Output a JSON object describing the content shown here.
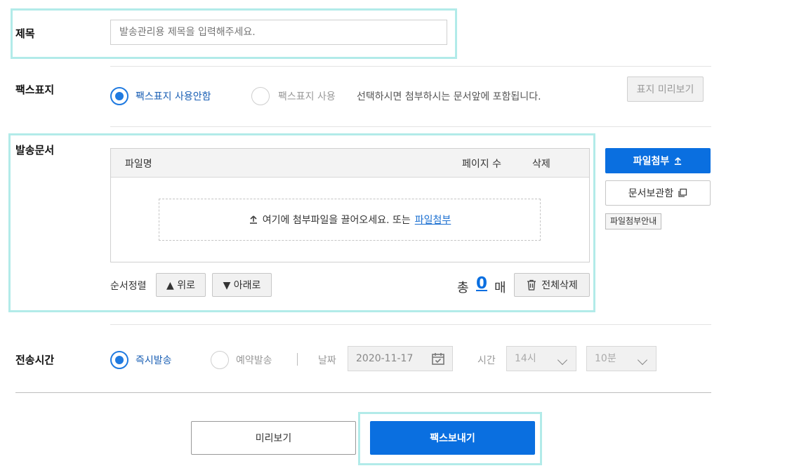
{
  "title_row": {
    "label": "제목",
    "placeholder": "발송관리용 제목을 입력해주세요."
  },
  "cover_row": {
    "label": "팩스표지",
    "option_off": "팩스표지 사용안함",
    "option_on": "팩스표지 사용",
    "hint": "선택하시면 첨부하시는 문서앞에 포함됩니다.",
    "preview_button": "표지 미리보기"
  },
  "docs_row": {
    "label": "발송문서",
    "columns": {
      "filename": "파일명",
      "pages": "페이지 수",
      "delete": "삭제"
    },
    "dropzone_text": "여기에 첨부파일을 끌어오세요. 또는",
    "dropzone_link": "파일첨부",
    "sort_label": "순서정렬",
    "up_button": "▲ 위로",
    "down_button": "▼ 아래로",
    "total_prefix": "총",
    "total_count": "0",
    "total_suffix": "매",
    "delete_all_button": "전체삭제",
    "attach_button": "파일첨부",
    "storage_button": "문서보관함",
    "attach_guide": "파일첨부안내"
  },
  "time_row": {
    "label": "전송시간",
    "option_now": "즉시발송",
    "option_reserve": "예약발송",
    "date_label": "날짜",
    "date_value": "2020-11-17",
    "time_label": "시간",
    "hour_value": "14시",
    "minute_value": "10분"
  },
  "actions": {
    "preview": "미리보기",
    "send": "팩스보내기"
  },
  "colors": {
    "accent": "#0a6fe0",
    "highlight": "#b2ebe9"
  }
}
